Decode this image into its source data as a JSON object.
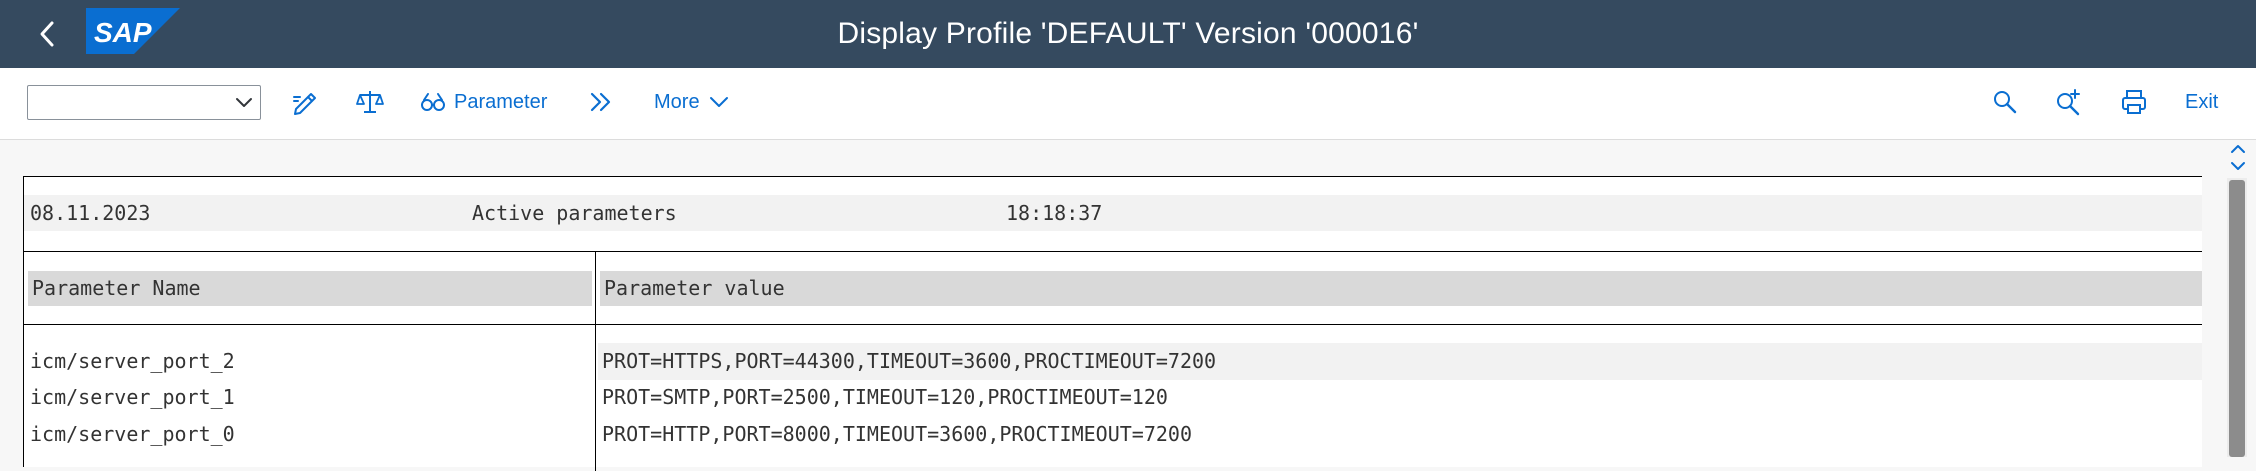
{
  "header": {
    "title": "Display Profile 'DEFAULT' Version '000016'",
    "logo_text": "SAP",
    "colors": {
      "shell": "#354a5f",
      "logo": "#0a6ed1"
    }
  },
  "toolbar": {
    "command_field": {
      "value": "",
      "placeholder": ""
    },
    "icons": [
      "edit-icon",
      "compare-icon",
      "display-icon",
      "double-chevron-icon",
      "search-icon",
      "search-next-icon",
      "print-icon"
    ],
    "parameter_label": "Parameter",
    "more_label": "More",
    "exit_label": "Exit"
  },
  "report": {
    "date": "08.11.2023",
    "heading": "Active parameters",
    "time": "18:18:37",
    "columns": [
      "Parameter Name",
      "Parameter value"
    ],
    "rows": [
      {
        "name": "icm/server_port_2",
        "value": "PROT=HTTPS,PORT=44300,TIMEOUT=3600,PROCTIMEOUT=7200"
      },
      {
        "name": "icm/server_port_1",
        "value": "PROT=SMTP,PORT=2500,TIMEOUT=120,PROCTIMEOUT=120"
      },
      {
        "name": "icm/server_port_0",
        "value": "PROT=HTTP,PORT=8000,TIMEOUT=3600,PROCTIMEOUT=7200"
      }
    ]
  }
}
